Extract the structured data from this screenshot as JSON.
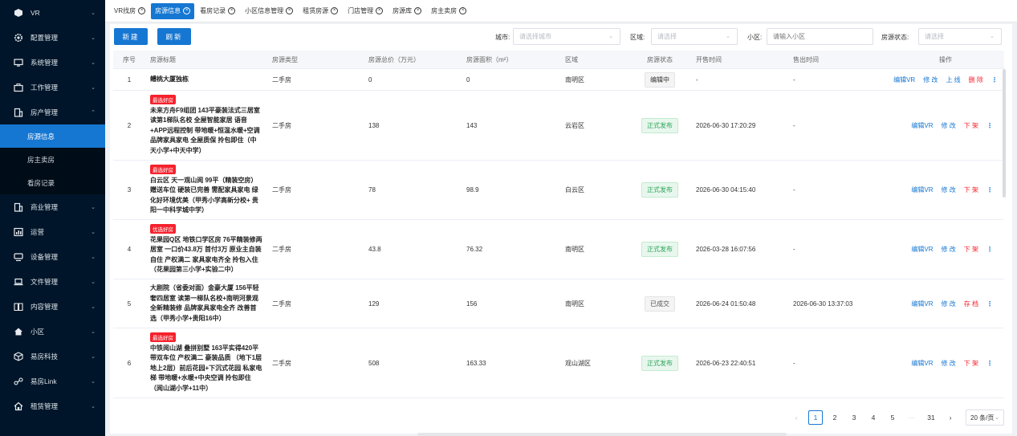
{
  "sidebar": {
    "items": [
      {
        "label": "VR",
        "icon": "cube-icon",
        "expanded": false
      },
      {
        "label": "配置管理",
        "icon": "gear-icon",
        "expanded": false
      },
      {
        "label": "系统管理",
        "icon": "monitor-icon",
        "expanded": false
      },
      {
        "label": "工作管理",
        "icon": "briefcase-icon",
        "expanded": false
      },
      {
        "label": "房产管理",
        "icon": "building-icon",
        "expanded": true
      },
      {
        "label": "商业管理",
        "icon": "building-icon",
        "expanded": false
      },
      {
        "label": "运营",
        "icon": "chart-icon",
        "expanded": false
      },
      {
        "label": "设备管理",
        "icon": "device-icon",
        "expanded": false
      },
      {
        "label": "文件管理",
        "icon": "laptop-icon",
        "expanded": false
      },
      {
        "label": "内容管理",
        "icon": "book-icon",
        "expanded": false
      },
      {
        "label": "小区",
        "icon": "home-icon",
        "expanded": false
      },
      {
        "label": "易房科技",
        "icon": "cube-outline-icon",
        "expanded": false
      },
      {
        "label": "易房Link",
        "icon": "link-icon",
        "expanded": false
      },
      {
        "label": "租赁管理",
        "icon": "house-outline-icon",
        "expanded": false
      }
    ],
    "subitems": [
      "房源信息",
      "房主卖房",
      "看房记录"
    ],
    "active_sub": "房源信息"
  },
  "tabs": [
    {
      "label": "VR找房",
      "active": false
    },
    {
      "label": "房源信息",
      "active": true
    },
    {
      "label": "看房记录",
      "active": false
    },
    {
      "label": "小区信息管理",
      "active": false
    },
    {
      "label": "租赁房源",
      "active": false
    },
    {
      "label": "门店管理",
      "active": false
    },
    {
      "label": "房源库",
      "active": false
    },
    {
      "label": "房主卖房",
      "active": false
    }
  ],
  "toolbar": {
    "new_label": "新建",
    "refresh_label": "刷新",
    "city_label": "城市:",
    "city_placeholder": "请选择城市",
    "district_label": "区域:",
    "district_placeholder": "请选择",
    "community_label": "小区:",
    "community_placeholder": "请输入小区",
    "status_label": "房源状态:",
    "status_placeholder": "请选择"
  },
  "table": {
    "headers": [
      "序号",
      "房源标题",
      "房源类型",
      "房源总价（万元）",
      "房源面积（m²）",
      "区域",
      "房源状态",
      "开售时间",
      "售出时间",
      "操作"
    ],
    "rows": [
      {
        "no": "1",
        "badge": "",
        "title": "鳢桃大厦独栋",
        "type": "二手房",
        "price": "0",
        "area": "0",
        "district": "南明区",
        "status": "编辑中",
        "status_kind": "edit",
        "sale_time": "-",
        "sold_time": "-",
        "ops": [
          {
            "t": "编辑VR",
            "c": "blue"
          },
          {
            "t": "修 改",
            "c": "blue"
          },
          {
            "t": "上 线",
            "c": "blue"
          },
          {
            "t": "删 除",
            "c": "red"
          }
        ]
      },
      {
        "no": "2",
        "badge": "最选好房",
        "title": "未来方舟F9组团 143平豪装法式三居室 读第1梯队名校 全屋智能家居 语音+APP远程控制 带地暖+恒温水暖+空调 品牌家具家电 全屋质保 拎包即住（中天小学+中天中学）",
        "type": "二手房",
        "price": "138",
        "area": "143",
        "district": "云岩区",
        "status": "正式发布",
        "status_kind": "pub",
        "sale_time": "2026-06-30 17:20:29",
        "sold_time": "-",
        "ops": [
          {
            "t": "编辑VR",
            "c": "blue"
          },
          {
            "t": "修 改",
            "c": "blue"
          },
          {
            "t": "下 架",
            "c": "red"
          }
        ]
      },
      {
        "no": "3",
        "badge": "最选好房",
        "title": "白云区 天一观山阅 99平（精装空房）赠送车位 硬装已完善 需配家具家电 绿化好环境优美（甲秀小学高新分校+ 贵阳一中科学城中学）",
        "type": "二手房",
        "price": "78",
        "area": "98.9",
        "district": "白云区",
        "status": "正式发布",
        "status_kind": "pub",
        "sale_time": "2026-06-30 04:15:40",
        "sold_time": "-",
        "ops": [
          {
            "t": "编辑VR",
            "c": "blue"
          },
          {
            "t": "修 改",
            "c": "blue"
          },
          {
            "t": "下 架",
            "c": "red"
          }
        ]
      },
      {
        "no": "4",
        "badge": "优选好房",
        "title": "花果园Q区 地铁口学区房 76平精装修两居室 一口价43.8万 首付3万 原业主自装自住 产权满二 家具家电齐全 拎包入住（花果园第三小学+实验二中）",
        "type": "二手房",
        "price": "43.8",
        "area": "76.32",
        "district": "南明区",
        "status": "正式发布",
        "status_kind": "pub",
        "sale_time": "2026-03-28 16:07:56",
        "sold_time": "-",
        "ops": [
          {
            "t": "编辑VR",
            "c": "blue"
          },
          {
            "t": "修 改",
            "c": "blue"
          },
          {
            "t": "下 架",
            "c": "red"
          }
        ]
      },
      {
        "no": "5",
        "badge": "",
        "title": "大剧院（省委对面）金豪大厦 156平轻奢四居室 读第一梯队名校+南明河景观 全新精装修 品牌家具家电全齐 改善首选（甲秀小学+贵阳16中）",
        "type": "二手房",
        "price": "129",
        "area": "156",
        "district": "南明区",
        "status": "已成交",
        "status_kind": "sold",
        "sale_time": "2026-06-24 01:50:48",
        "sold_time": "2026-06-30 13:37:03",
        "ops": [
          {
            "t": "编辑VR",
            "c": "blue"
          },
          {
            "t": "修 改",
            "c": "blue"
          },
          {
            "t": "存 档",
            "c": "red"
          }
        ]
      },
      {
        "no": "6",
        "badge": "最选好房",
        "title": "中铁阅山湖 叠拼别墅 163平实得420平 带双车位 产权满二 豪装品质 （地下1层 地上2层）前后花园+下沉式花园 私家电梯 带地暖+水暖+中央空调 拎包即住（阅山湖小学+11中）",
        "type": "二手房",
        "price": "508",
        "area": "163.33",
        "district": "观山湖区",
        "status": "正式发布",
        "status_kind": "pub",
        "sale_time": "2026-06-23 22:40:51",
        "sold_time": "-",
        "ops": [
          {
            "t": "编辑VR",
            "c": "blue"
          },
          {
            "t": "修 改",
            "c": "blue"
          },
          {
            "t": "下 架",
            "c": "red"
          }
        ]
      }
    ]
  },
  "pagination": {
    "pages": [
      "1",
      "2",
      "3",
      "4",
      "5",
      "···",
      "31"
    ],
    "current": "1",
    "prev": "‹",
    "next": "›",
    "page_size": "20 条/页"
  },
  "colors": {
    "sidebar_bg": "#001529",
    "accent": "#1677d2",
    "danger": "#f5222d",
    "published": "#2fa55a"
  }
}
